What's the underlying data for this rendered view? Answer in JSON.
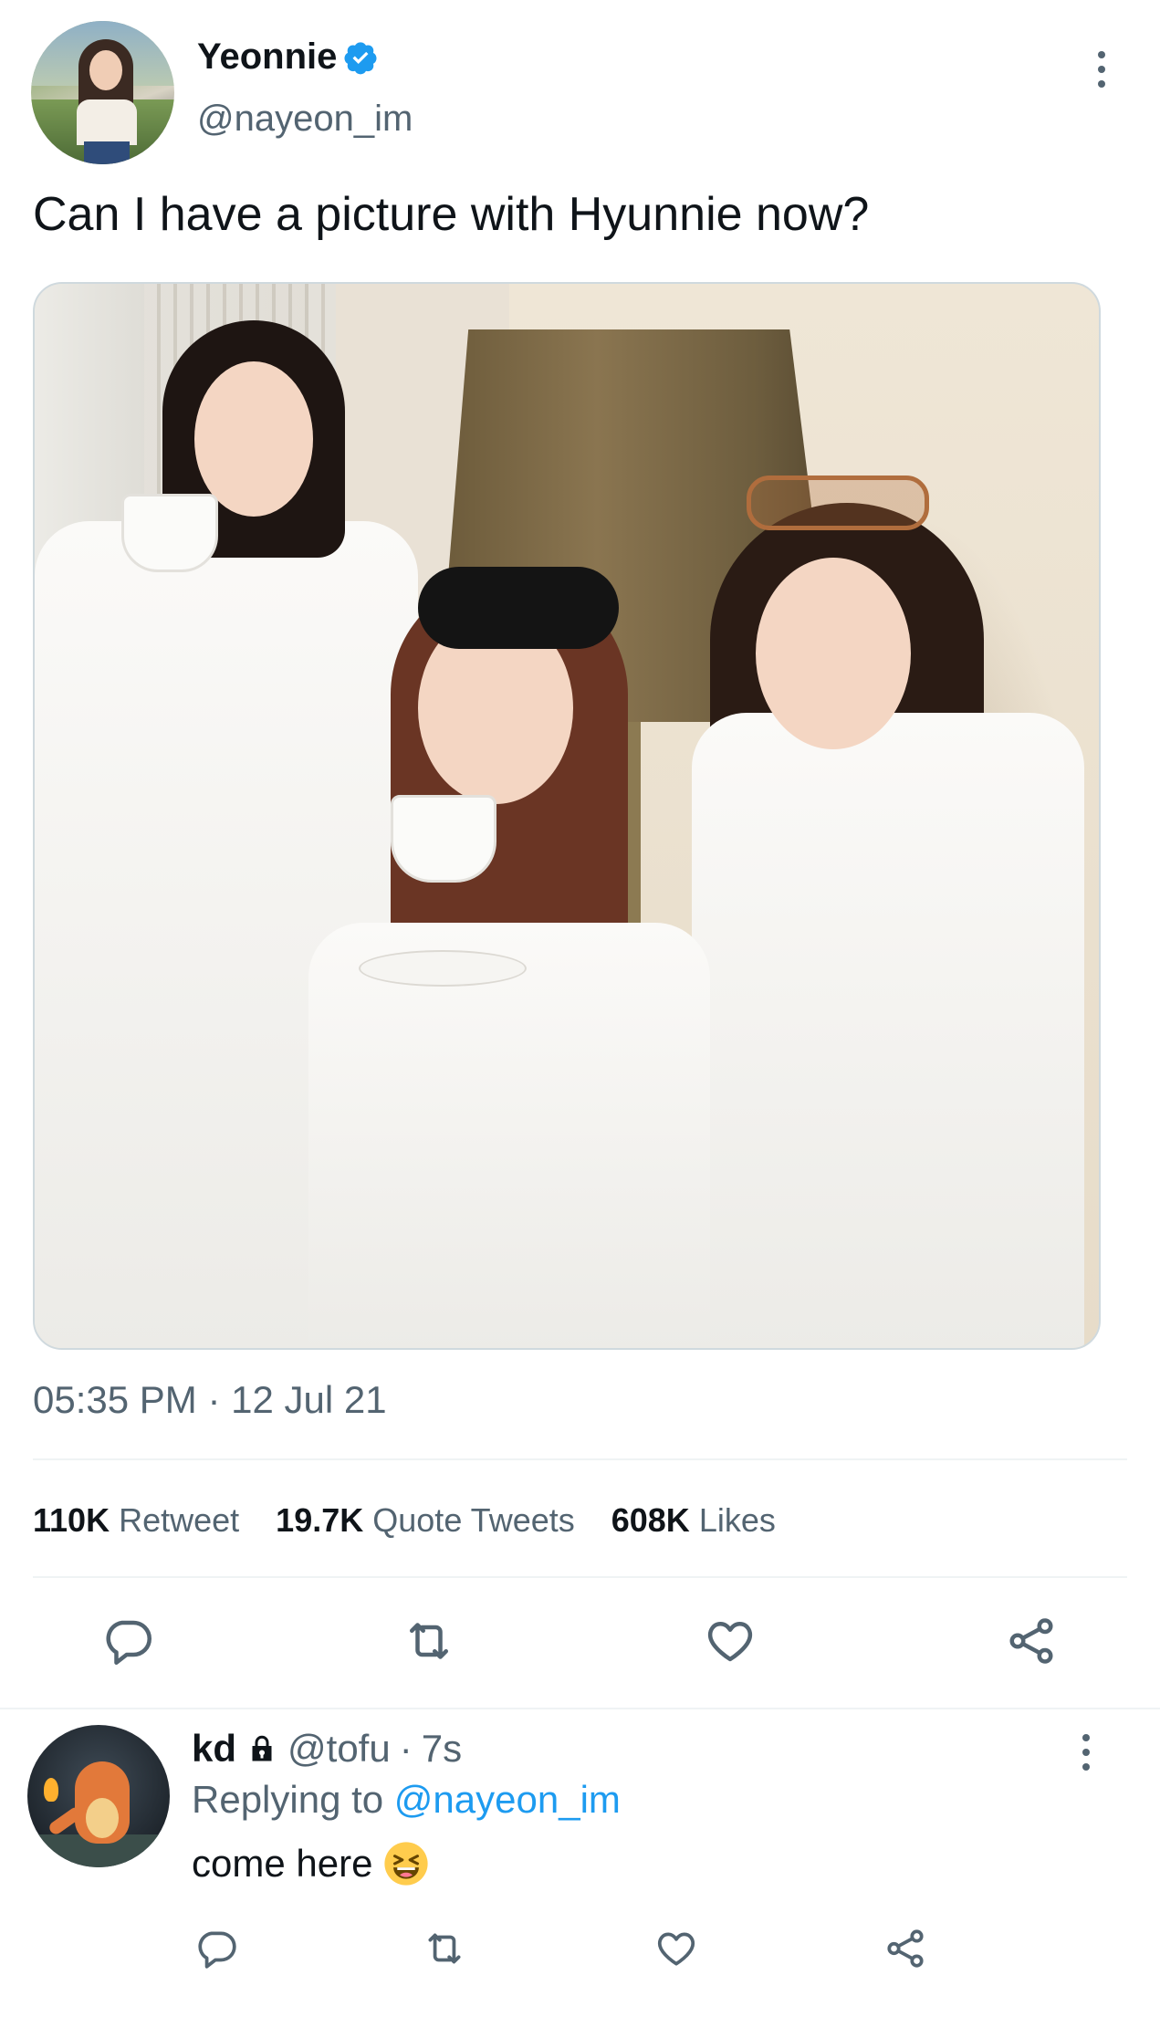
{
  "tweet": {
    "author": {
      "display_name": "Yeonnie",
      "handle": "@nayeon_im",
      "verified": true
    },
    "text": "Can I have a picture with Hyunnie now?",
    "timestamp": "05:35 PM · 12 Jul 21",
    "stats": {
      "retweets": "110K",
      "retweets_label": "Retweet",
      "quotes": "19.7K",
      "quotes_label": "Quote Tweets",
      "likes": "608K",
      "likes_label": "Likes"
    },
    "actions": [
      "reply-icon",
      "retweet-icon",
      "like-icon",
      "share-icon"
    ]
  },
  "reply": {
    "author": {
      "display_name": "kd",
      "protected": true,
      "handle": "@tofu",
      "age": "7s"
    },
    "replying_prefix": "Replying to",
    "replying_to": "@nayeon_im",
    "text": "come here",
    "emoji": "grinning-squinting-face",
    "actions": [
      "reply-icon",
      "retweet-icon",
      "like-icon",
      "share-icon"
    ]
  },
  "colors": {
    "text": "#0f1419",
    "secondary": "#536471",
    "accent": "#1d9bf0",
    "divider": "#eff3f4"
  }
}
